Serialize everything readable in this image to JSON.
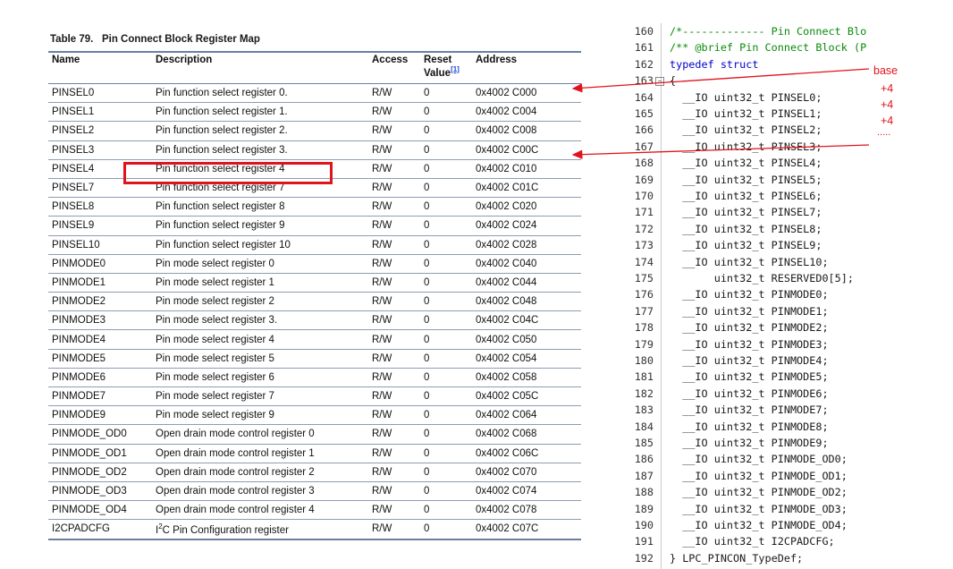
{
  "table": {
    "caption": "Table 79.   Pin Connect Block Register Map",
    "headers": {
      "name": "Name",
      "description": "Description",
      "access": "Access",
      "reset": "Reset Value",
      "reset_ref": "[1]",
      "address": "Address"
    },
    "rows": [
      {
        "name": "PINSEL0",
        "desc": "Pin function select register 0.",
        "access": "R/W",
        "reset": "0",
        "addr": "0x4002 C000"
      },
      {
        "name": "PINSEL1",
        "desc": "Pin function select register 1.",
        "access": "R/W",
        "reset": "0",
        "addr": "0x4002 C004"
      },
      {
        "name": "PINSEL2",
        "desc": "Pin function select register 2.",
        "access": "R/W",
        "reset": "0",
        "addr": "0x4002 C008"
      },
      {
        "name": "PINSEL3",
        "desc": "Pin function select register 3.",
        "access": "R/W",
        "reset": "0",
        "addr": "0x4002 C00C"
      },
      {
        "name": "PINSEL4",
        "desc": "Pin function select register 4",
        "access": "R/W",
        "reset": "0",
        "addr": "0x4002 C010"
      },
      {
        "name": "PINSEL7",
        "desc": "Pin function select register 7",
        "access": "R/W",
        "reset": "0",
        "addr": "0x4002 C01C"
      },
      {
        "name": "PINSEL8",
        "desc": "Pin function select register 8",
        "access": "R/W",
        "reset": "0",
        "addr": "0x4002 C020"
      },
      {
        "name": "PINSEL9",
        "desc": "Pin function select register 9",
        "access": "R/W",
        "reset": "0",
        "addr": "0x4002 C024"
      },
      {
        "name": "PINSEL10",
        "desc": "Pin function select register 10",
        "access": "R/W",
        "reset": "0",
        "addr": "0x4002 C028"
      },
      {
        "name": "PINMODE0",
        "desc": "Pin mode select register 0",
        "access": "R/W",
        "reset": "0",
        "addr": "0x4002 C040"
      },
      {
        "name": "PINMODE1",
        "desc": "Pin mode select register 1",
        "access": "R/W",
        "reset": "0",
        "addr": "0x4002 C044"
      },
      {
        "name": "PINMODE2",
        "desc": "Pin mode select register 2",
        "access": "R/W",
        "reset": "0",
        "addr": "0x4002 C048"
      },
      {
        "name": "PINMODE3",
        "desc": "Pin mode select register 3.",
        "access": "R/W",
        "reset": "0",
        "addr": "0x4002 C04C"
      },
      {
        "name": "PINMODE4",
        "desc": "Pin mode select register 4",
        "access": "R/W",
        "reset": "0",
        "addr": "0x4002 C050"
      },
      {
        "name": "PINMODE5",
        "desc": "Pin mode select register 5",
        "access": "R/W",
        "reset": "0",
        "addr": "0x4002 C054"
      },
      {
        "name": "PINMODE6",
        "desc": "Pin mode select register 6",
        "access": "R/W",
        "reset": "0",
        "addr": "0x4002 C058"
      },
      {
        "name": "PINMODE7",
        "desc": "Pin mode select register 7",
        "access": "R/W",
        "reset": "0",
        "addr": "0x4002 C05C"
      },
      {
        "name": "PINMODE9",
        "desc": "Pin mode select register 9",
        "access": "R/W",
        "reset": "0",
        "addr": "0x4002 C064"
      },
      {
        "name": "PINMODE_OD0",
        "desc": "Open drain mode control register 0",
        "access": "R/W",
        "reset": "0",
        "addr": "0x4002 C068"
      },
      {
        "name": "PINMODE_OD1",
        "desc": "Open drain mode control register 1",
        "access": "R/W",
        "reset": "0",
        "addr": "0x4002 C06C"
      },
      {
        "name": "PINMODE_OD2",
        "desc": "Open drain mode control register 2",
        "access": "R/W",
        "reset": "0",
        "addr": "0x4002 C070"
      },
      {
        "name": "PINMODE_OD3",
        "desc": "Open drain mode control register 3",
        "access": "R/W",
        "reset": "0",
        "addr": "0x4002 C074"
      },
      {
        "name": "PINMODE_OD4",
        "desc": "Open drain mode control register 4",
        "access": "R/W",
        "reset": "0",
        "addr": "0x4002 C078"
      },
      {
        "name": "I2CPADCFG",
        "desc_prefix": "I",
        "desc_sup": "2",
        "desc_rest": "C Pin Configuration register",
        "access": "R/W",
        "reset": "0",
        "addr": "0x4002 C07C"
      }
    ]
  },
  "code": {
    "lines": [
      {
        "n": "160",
        "text": "/*------------- Pin Connect Blo",
        "kind": "comment"
      },
      {
        "n": "161",
        "text": "/** @brief Pin Connect Block (P",
        "kind": "comment"
      },
      {
        "n": "162",
        "text": "typedef struct",
        "kind": "kw"
      },
      {
        "n": "163",
        "text": "{",
        "kind": "plain",
        "fold": true
      },
      {
        "n": "164",
        "text": "  __IO uint32_t PINSEL0;",
        "kind": "plain"
      },
      {
        "n": "165",
        "text": "  __IO uint32_t PINSEL1;",
        "kind": "plain"
      },
      {
        "n": "166",
        "text": "  __IO uint32_t PINSEL2;",
        "kind": "plain"
      },
      {
        "n": "167",
        "text": "  __IO uint32_t PINSEL3;",
        "kind": "plain"
      },
      {
        "n": "168",
        "text": "  __IO uint32_t PINSEL4;",
        "kind": "plain"
      },
      {
        "n": "169",
        "text": "  __IO uint32_t PINSEL5;",
        "kind": "plain"
      },
      {
        "n": "170",
        "text": "  __IO uint32_t PINSEL6;",
        "kind": "plain"
      },
      {
        "n": "171",
        "text": "  __IO uint32_t PINSEL7;",
        "kind": "plain"
      },
      {
        "n": "172",
        "text": "  __IO uint32_t PINSEL8;",
        "kind": "plain"
      },
      {
        "n": "173",
        "text": "  __IO uint32_t PINSEL9;",
        "kind": "plain"
      },
      {
        "n": "174",
        "text": "  __IO uint32_t PINSEL10;",
        "kind": "plain"
      },
      {
        "n": "175",
        "text": "       uint32_t RESERVED0[5];",
        "kind": "plain"
      },
      {
        "n": "176",
        "text": "  __IO uint32_t PINMODE0;",
        "kind": "plain"
      },
      {
        "n": "177",
        "text": "  __IO uint32_t PINMODE1;",
        "kind": "plain"
      },
      {
        "n": "178",
        "text": "  __IO uint32_t PINMODE2;",
        "kind": "plain"
      },
      {
        "n": "179",
        "text": "  __IO uint32_t PINMODE3;",
        "kind": "plain"
      },
      {
        "n": "180",
        "text": "  __IO uint32_t PINMODE4;",
        "kind": "plain"
      },
      {
        "n": "181",
        "text": "  __IO uint32_t PINMODE5;",
        "kind": "plain"
      },
      {
        "n": "182",
        "text": "  __IO uint32_t PINMODE6;",
        "kind": "plain"
      },
      {
        "n": "183",
        "text": "  __IO uint32_t PINMODE7;",
        "kind": "plain"
      },
      {
        "n": "184",
        "text": "  __IO uint32_t PINMODE8;",
        "kind": "plain"
      },
      {
        "n": "185",
        "text": "  __IO uint32_t PINMODE9;",
        "kind": "plain"
      },
      {
        "n": "186",
        "text": "  __IO uint32_t PINMODE_OD0;",
        "kind": "plain"
      },
      {
        "n": "187",
        "text": "  __IO uint32_t PINMODE_OD1;",
        "kind": "plain"
      },
      {
        "n": "188",
        "text": "  __IO uint32_t PINMODE_OD2;",
        "kind": "plain"
      },
      {
        "n": "189",
        "text": "  __IO uint32_t PINMODE_OD3;",
        "kind": "plain"
      },
      {
        "n": "190",
        "text": "  __IO uint32_t PINMODE_OD4;",
        "kind": "plain"
      },
      {
        "n": "191",
        "text": "  __IO uint32_t I2CPADCFG;",
        "kind": "plain"
      },
      {
        "n": "192",
        "text": "} LPC_PINCON_TypeDef;",
        "kind": "plain"
      }
    ],
    "annotations": {
      "base": "base",
      "plus1": "+4",
      "plus2": "+4",
      "plus3": "+4",
      "dots": "....."
    }
  },
  "colors": {
    "annotation": "#e0141b",
    "comment": "#0a8a0a",
    "keyword": "#0000c8",
    "table_rule": "#6b7fa3"
  }
}
